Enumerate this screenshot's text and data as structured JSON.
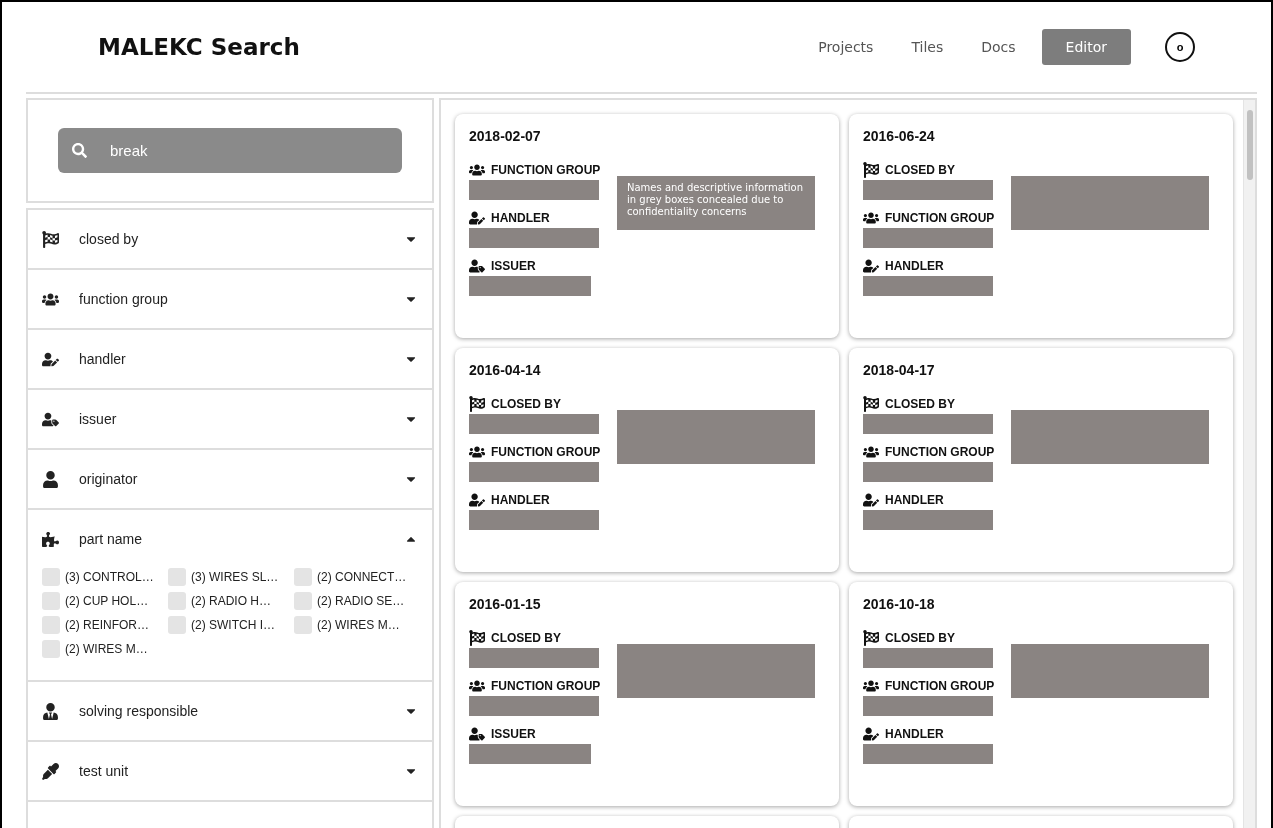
{
  "header": {
    "title": "MALEKC Search",
    "nav": [
      {
        "label": "Projects",
        "selected": false
      },
      {
        "label": "Tiles",
        "selected": false
      },
      {
        "label": "Docs",
        "selected": false
      },
      {
        "label": "Editor",
        "selected": true
      }
    ],
    "avatar": "o"
  },
  "search": {
    "value": "break"
  },
  "filters": [
    {
      "kind": "closed_by",
      "label": "closed by",
      "expanded": false
    },
    {
      "kind": "function_group",
      "label": "function group",
      "expanded": false
    },
    {
      "kind": "handler",
      "label": "handler",
      "expanded": false
    },
    {
      "kind": "issuer",
      "label": "issuer",
      "expanded": false
    },
    {
      "kind": "originator",
      "label": "originator",
      "expanded": false
    },
    {
      "kind": "part_name",
      "label": "part name",
      "expanded": true,
      "options": [
        {
          "label": "(3) CONTROL…",
          "checked": false
        },
        {
          "label": "(3) WIRES SL…",
          "checked": false
        },
        {
          "label": "(2) CONNECT…",
          "checked": false
        },
        {
          "label": "(2) CUP HOL…",
          "checked": false
        },
        {
          "label": "(2) RADIO H…",
          "checked": false
        },
        {
          "label": "(2) RADIO SE…",
          "checked": false
        },
        {
          "label": "(2) REINFOR…",
          "checked": false
        },
        {
          "label": "(2) SWITCH I…",
          "checked": false
        },
        {
          "label": "(2) WIRES M…",
          "checked": false
        },
        {
          "label": "(2) WIRES M…",
          "checked": false
        }
      ]
    },
    {
      "kind": "solving_responsible",
      "label": "solving responsible",
      "expanded": false
    },
    {
      "kind": "test_unit",
      "label": "test unit",
      "expanded": false
    }
  ],
  "cards": [
    {
      "date": "2018-02-07",
      "note": "Names and descriptive information in grey boxes concealed due to confidentiality concerns",
      "fields": [
        {
          "kind": "function_group",
          "label": "FUNCTION GROUP"
        },
        {
          "kind": "handler",
          "label": "HANDLER"
        },
        {
          "kind": "issuer",
          "label": "ISSUER"
        }
      ]
    },
    {
      "date": "2016-06-24",
      "fields": [
        {
          "kind": "closed_by",
          "label": "CLOSED BY"
        },
        {
          "kind": "function_group",
          "label": "FUNCTION GROUP"
        },
        {
          "kind": "handler",
          "label": "HANDLER"
        }
      ]
    },
    {
      "date": "2016-04-14",
      "fields": [
        {
          "kind": "closed_by",
          "label": "CLOSED BY"
        },
        {
          "kind": "function_group",
          "label": "FUNCTION GROUP"
        },
        {
          "kind": "handler",
          "label": "HANDLER"
        }
      ]
    },
    {
      "date": "2018-04-17",
      "fields": [
        {
          "kind": "closed_by",
          "label": "CLOSED BY"
        },
        {
          "kind": "function_group",
          "label": "FUNCTION GROUP"
        },
        {
          "kind": "handler",
          "label": "HANDLER"
        }
      ]
    },
    {
      "date": "2016-01-15",
      "fields": [
        {
          "kind": "closed_by",
          "label": "CLOSED BY"
        },
        {
          "kind": "function_group",
          "label": "FUNCTION GROUP"
        },
        {
          "kind": "issuer",
          "label": "ISSUER"
        }
      ]
    },
    {
      "date": "2016-10-18",
      "fields": [
        {
          "kind": "closed_by",
          "label": "CLOSED BY"
        },
        {
          "kind": "function_group",
          "label": "FUNCTION GROUP"
        },
        {
          "kind": "handler",
          "label": "HANDLER"
        }
      ]
    }
  ]
}
